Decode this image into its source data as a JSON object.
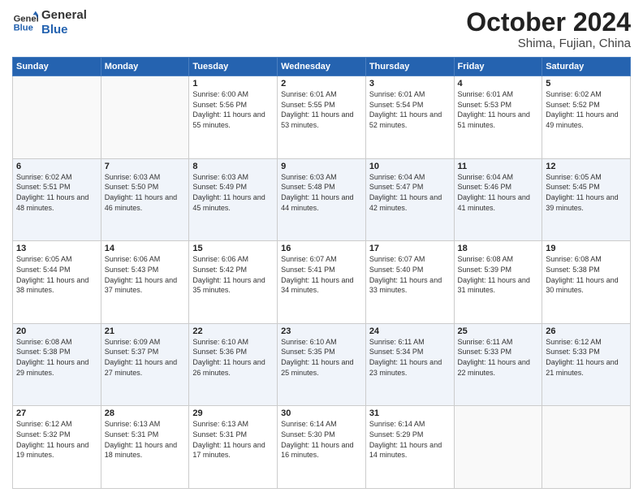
{
  "header": {
    "logo_line1": "General",
    "logo_line2": "Blue",
    "month": "October 2024",
    "location": "Shima, Fujian, China"
  },
  "weekdays": [
    "Sunday",
    "Monday",
    "Tuesday",
    "Wednesday",
    "Thursday",
    "Friday",
    "Saturday"
  ],
  "weeks": [
    [
      {
        "day": "",
        "info": ""
      },
      {
        "day": "",
        "info": ""
      },
      {
        "day": "1",
        "info": "Sunrise: 6:00 AM\nSunset: 5:56 PM\nDaylight: 11 hours and 55 minutes."
      },
      {
        "day": "2",
        "info": "Sunrise: 6:01 AM\nSunset: 5:55 PM\nDaylight: 11 hours and 53 minutes."
      },
      {
        "day": "3",
        "info": "Sunrise: 6:01 AM\nSunset: 5:54 PM\nDaylight: 11 hours and 52 minutes."
      },
      {
        "day": "4",
        "info": "Sunrise: 6:01 AM\nSunset: 5:53 PM\nDaylight: 11 hours and 51 minutes."
      },
      {
        "day": "5",
        "info": "Sunrise: 6:02 AM\nSunset: 5:52 PM\nDaylight: 11 hours and 49 minutes."
      }
    ],
    [
      {
        "day": "6",
        "info": "Sunrise: 6:02 AM\nSunset: 5:51 PM\nDaylight: 11 hours and 48 minutes."
      },
      {
        "day": "7",
        "info": "Sunrise: 6:03 AM\nSunset: 5:50 PM\nDaylight: 11 hours and 46 minutes."
      },
      {
        "day": "8",
        "info": "Sunrise: 6:03 AM\nSunset: 5:49 PM\nDaylight: 11 hours and 45 minutes."
      },
      {
        "day": "9",
        "info": "Sunrise: 6:03 AM\nSunset: 5:48 PM\nDaylight: 11 hours and 44 minutes."
      },
      {
        "day": "10",
        "info": "Sunrise: 6:04 AM\nSunset: 5:47 PM\nDaylight: 11 hours and 42 minutes."
      },
      {
        "day": "11",
        "info": "Sunrise: 6:04 AM\nSunset: 5:46 PM\nDaylight: 11 hours and 41 minutes."
      },
      {
        "day": "12",
        "info": "Sunrise: 6:05 AM\nSunset: 5:45 PM\nDaylight: 11 hours and 39 minutes."
      }
    ],
    [
      {
        "day": "13",
        "info": "Sunrise: 6:05 AM\nSunset: 5:44 PM\nDaylight: 11 hours and 38 minutes."
      },
      {
        "day": "14",
        "info": "Sunrise: 6:06 AM\nSunset: 5:43 PM\nDaylight: 11 hours and 37 minutes."
      },
      {
        "day": "15",
        "info": "Sunrise: 6:06 AM\nSunset: 5:42 PM\nDaylight: 11 hours and 35 minutes."
      },
      {
        "day": "16",
        "info": "Sunrise: 6:07 AM\nSunset: 5:41 PM\nDaylight: 11 hours and 34 minutes."
      },
      {
        "day": "17",
        "info": "Sunrise: 6:07 AM\nSunset: 5:40 PM\nDaylight: 11 hours and 33 minutes."
      },
      {
        "day": "18",
        "info": "Sunrise: 6:08 AM\nSunset: 5:39 PM\nDaylight: 11 hours and 31 minutes."
      },
      {
        "day": "19",
        "info": "Sunrise: 6:08 AM\nSunset: 5:38 PM\nDaylight: 11 hours and 30 minutes."
      }
    ],
    [
      {
        "day": "20",
        "info": "Sunrise: 6:08 AM\nSunset: 5:38 PM\nDaylight: 11 hours and 29 minutes."
      },
      {
        "day": "21",
        "info": "Sunrise: 6:09 AM\nSunset: 5:37 PM\nDaylight: 11 hours and 27 minutes."
      },
      {
        "day": "22",
        "info": "Sunrise: 6:10 AM\nSunset: 5:36 PM\nDaylight: 11 hours and 26 minutes."
      },
      {
        "day": "23",
        "info": "Sunrise: 6:10 AM\nSunset: 5:35 PM\nDaylight: 11 hours and 25 minutes."
      },
      {
        "day": "24",
        "info": "Sunrise: 6:11 AM\nSunset: 5:34 PM\nDaylight: 11 hours and 23 minutes."
      },
      {
        "day": "25",
        "info": "Sunrise: 6:11 AM\nSunset: 5:33 PM\nDaylight: 11 hours and 22 minutes."
      },
      {
        "day": "26",
        "info": "Sunrise: 6:12 AM\nSunset: 5:33 PM\nDaylight: 11 hours and 21 minutes."
      }
    ],
    [
      {
        "day": "27",
        "info": "Sunrise: 6:12 AM\nSunset: 5:32 PM\nDaylight: 11 hours and 19 minutes."
      },
      {
        "day": "28",
        "info": "Sunrise: 6:13 AM\nSunset: 5:31 PM\nDaylight: 11 hours and 18 minutes."
      },
      {
        "day": "29",
        "info": "Sunrise: 6:13 AM\nSunset: 5:31 PM\nDaylight: 11 hours and 17 minutes."
      },
      {
        "day": "30",
        "info": "Sunrise: 6:14 AM\nSunset: 5:30 PM\nDaylight: 11 hours and 16 minutes."
      },
      {
        "day": "31",
        "info": "Sunrise: 6:14 AM\nSunset: 5:29 PM\nDaylight: 11 hours and 14 minutes."
      },
      {
        "day": "",
        "info": ""
      },
      {
        "day": "",
        "info": ""
      }
    ]
  ]
}
